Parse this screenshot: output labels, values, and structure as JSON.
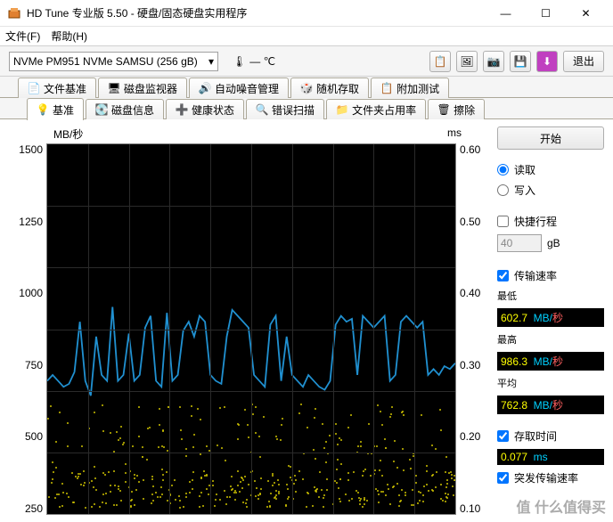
{
  "window": {
    "title": "HD Tune 专业版 5.50 - 硬盘/固态硬盘实用程序",
    "min": "—",
    "max": "☐",
    "close": "✕"
  },
  "menu": {
    "file": "文件(F)",
    "help": "帮助(H)"
  },
  "toolbar": {
    "drive": "NVMe   PM951 NVMe SAMSU (256 gB)",
    "temp": "— ℃",
    "exit": "退出"
  },
  "tabs_top": [
    {
      "icon": "📄",
      "label": "文件基准"
    },
    {
      "icon": "🖥",
      "label": "磁盘监视器"
    },
    {
      "icon": "🔊",
      "label": "自动噪音管理"
    },
    {
      "icon": "🎲",
      "label": "随机存取"
    },
    {
      "icon": "📋",
      "label": "附加测试"
    }
  ],
  "tabs_bot": [
    {
      "icon": "💡",
      "label": "基准",
      "active": true
    },
    {
      "icon": "💽",
      "label": "磁盘信息"
    },
    {
      "icon": "➕",
      "label": "健康状态"
    },
    {
      "icon": "🔍",
      "label": "错误扫描"
    },
    {
      "icon": "📁",
      "label": "文件夹占用率"
    },
    {
      "icon": "🗑",
      "label": "擦除"
    }
  ],
  "chart": {
    "ylabel_left": "MB/秒",
    "ylabel_right": "ms",
    "yticks_left": [
      "1500",
      "1250",
      "1000",
      "750",
      "500",
      "250"
    ],
    "yticks_right": [
      "0.60",
      "0.50",
      "0.40",
      "0.30",
      "0.20",
      "0.10"
    ]
  },
  "chart_data": {
    "type": "line",
    "title": "",
    "xlabel": "",
    "ylabel": "MB/秒",
    "ylim_left": [
      0,
      1500
    ],
    "ylim_right": [
      0,
      0.6
    ],
    "series": [
      {
        "name": "传输速率",
        "axis": "left",
        "values": [
          700,
          720,
          700,
          680,
          690,
          730,
          900,
          700,
          650,
          850,
          720,
          700,
          950,
          700,
          720,
          860,
          700,
          720,
          880,
          920,
          700,
          680,
          930,
          700,
          720,
          870,
          900,
          850,
          920,
          900,
          720,
          700,
          690,
          850,
          940,
          920,
          900,
          880,
          720,
          700,
          680,
          890,
          920,
          700,
          850,
          720,
          700,
          680,
          720,
          700,
          680,
          670,
          700,
          890,
          920,
          900,
          910,
          720,
          920,
          900,
          880,
          900,
          920,
          700,
          720,
          900,
          920,
          900,
          880,
          900,
          720,
          740,
          720,
          750,
          740,
          760
        ]
      },
      {
        "name": "存取时间",
        "axis": "right",
        "type": "scatter",
        "note": "yellow dots clustered 0.02–0.12 ms band"
      }
    ]
  },
  "side": {
    "start": "开始",
    "read": "读取",
    "write": "写入",
    "quick": "快捷行程",
    "quick_val": "40",
    "gb": "gB",
    "rate_chk": "传输速率",
    "min_lbl": "最低",
    "min_val": "602.7",
    "min_unit": "MB/",
    "min_unit2": "秒",
    "max_lbl": "最高",
    "max_val": "986.3",
    "max_unit": "MB/",
    "max_unit2": "秒",
    "avg_lbl": "平均",
    "avg_val": "762.8",
    "avg_unit": "MB/",
    "avg_unit2": "秒",
    "access_chk": "存取时间",
    "access_val": "0.077",
    "access_unit": "ms",
    "burst_chk": "突发传输速率"
  },
  "watermark": "值 什么值得买"
}
